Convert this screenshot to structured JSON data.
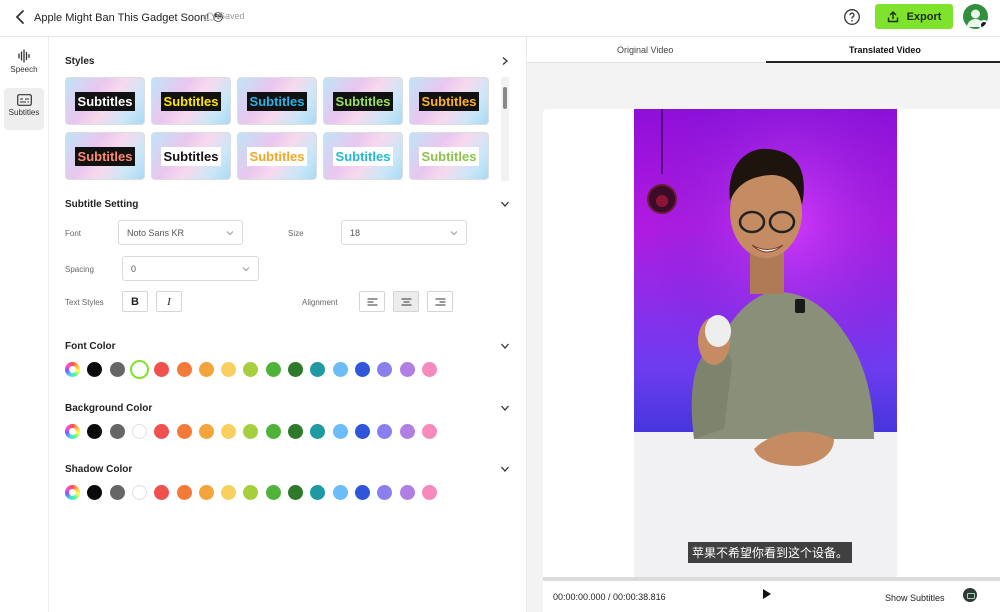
{
  "header": {
    "title": "Apple Might Ban This Gadget Soon! 😳",
    "saved_label": "Saved",
    "export_label": "Export"
  },
  "rail": {
    "items": [
      {
        "label": "Speech",
        "icon": "speech-waveform-icon"
      },
      {
        "label": "Subtitles",
        "icon": "subtitles-icon",
        "active": true
      }
    ]
  },
  "styles": {
    "title": "Styles",
    "cards": [
      {
        "label": "Subtitles",
        "text_color": "#ffffff",
        "bg": "#111111"
      },
      {
        "label": "Subtitles",
        "text_color": "#ffe600",
        "bg": "#111111"
      },
      {
        "label": "Subtitles",
        "text_color": "#28b4e8",
        "bg": "#111111"
      },
      {
        "label": "Subtitles",
        "text_color": "#9be15d",
        "bg": "#111111"
      },
      {
        "label": "Subtitles",
        "text_color": "#ffb21f",
        "bg": "#111111"
      },
      {
        "label": "Subtitles",
        "text_color": "#ff8a70",
        "bg": "#111111"
      },
      {
        "label": "Subtitles",
        "text_color": "#111111",
        "bg": "#ffffff"
      },
      {
        "label": "Subtitles",
        "text_color": "#f5a623",
        "bg": "#ffffff"
      },
      {
        "label": "Subtitles",
        "text_color": "#22b8d6",
        "bg": "#ffffff"
      },
      {
        "label": "Subtitles",
        "text_color": "#8bc34a",
        "bg": "#ffffff"
      }
    ]
  },
  "subtitle_setting": {
    "title": "Subtitle Setting",
    "font_label": "Font",
    "font_value": "Noto Sans KR",
    "size_label": "Size",
    "size_value": "18",
    "spacing_label": "Spacing",
    "spacing_value": "0",
    "text_styles_label": "Text Styles",
    "bold_label": "B",
    "italic_label": "I",
    "alignment_label": "Alignment",
    "alignment_selected": "center"
  },
  "font_color": {
    "title": "Font Color",
    "selected_index": 3
  },
  "background_color": {
    "title": "Background Color"
  },
  "shadow_color": {
    "title": "Shadow Color"
  },
  "palette": [
    "rainbow",
    "#0a0a0a",
    "#666666",
    "#ffffff",
    "#f0504e",
    "#f47a3a",
    "#f5a43c",
    "#f7d060",
    "#a5cf3f",
    "#4fb33a",
    "#2d7a2a",
    "#1f9aa3",
    "#6cbcf7",
    "#2f55d9",
    "#8b7ff0",
    "#b07fe2",
    "#f58bbd"
  ],
  "preview": {
    "tab_original": "Original Video",
    "tab_translated": "Translated Video",
    "active_tab": "Translated Video",
    "subtitle_text": "苹果不希望你看到这个设备。",
    "time_current": "00:00:00.000",
    "time_total": "00:00:38.816",
    "time_display": "00:00:00.000 / 00:00:38.816",
    "show_subtitles_label": "Show Subtitles",
    "progress": 0
  }
}
